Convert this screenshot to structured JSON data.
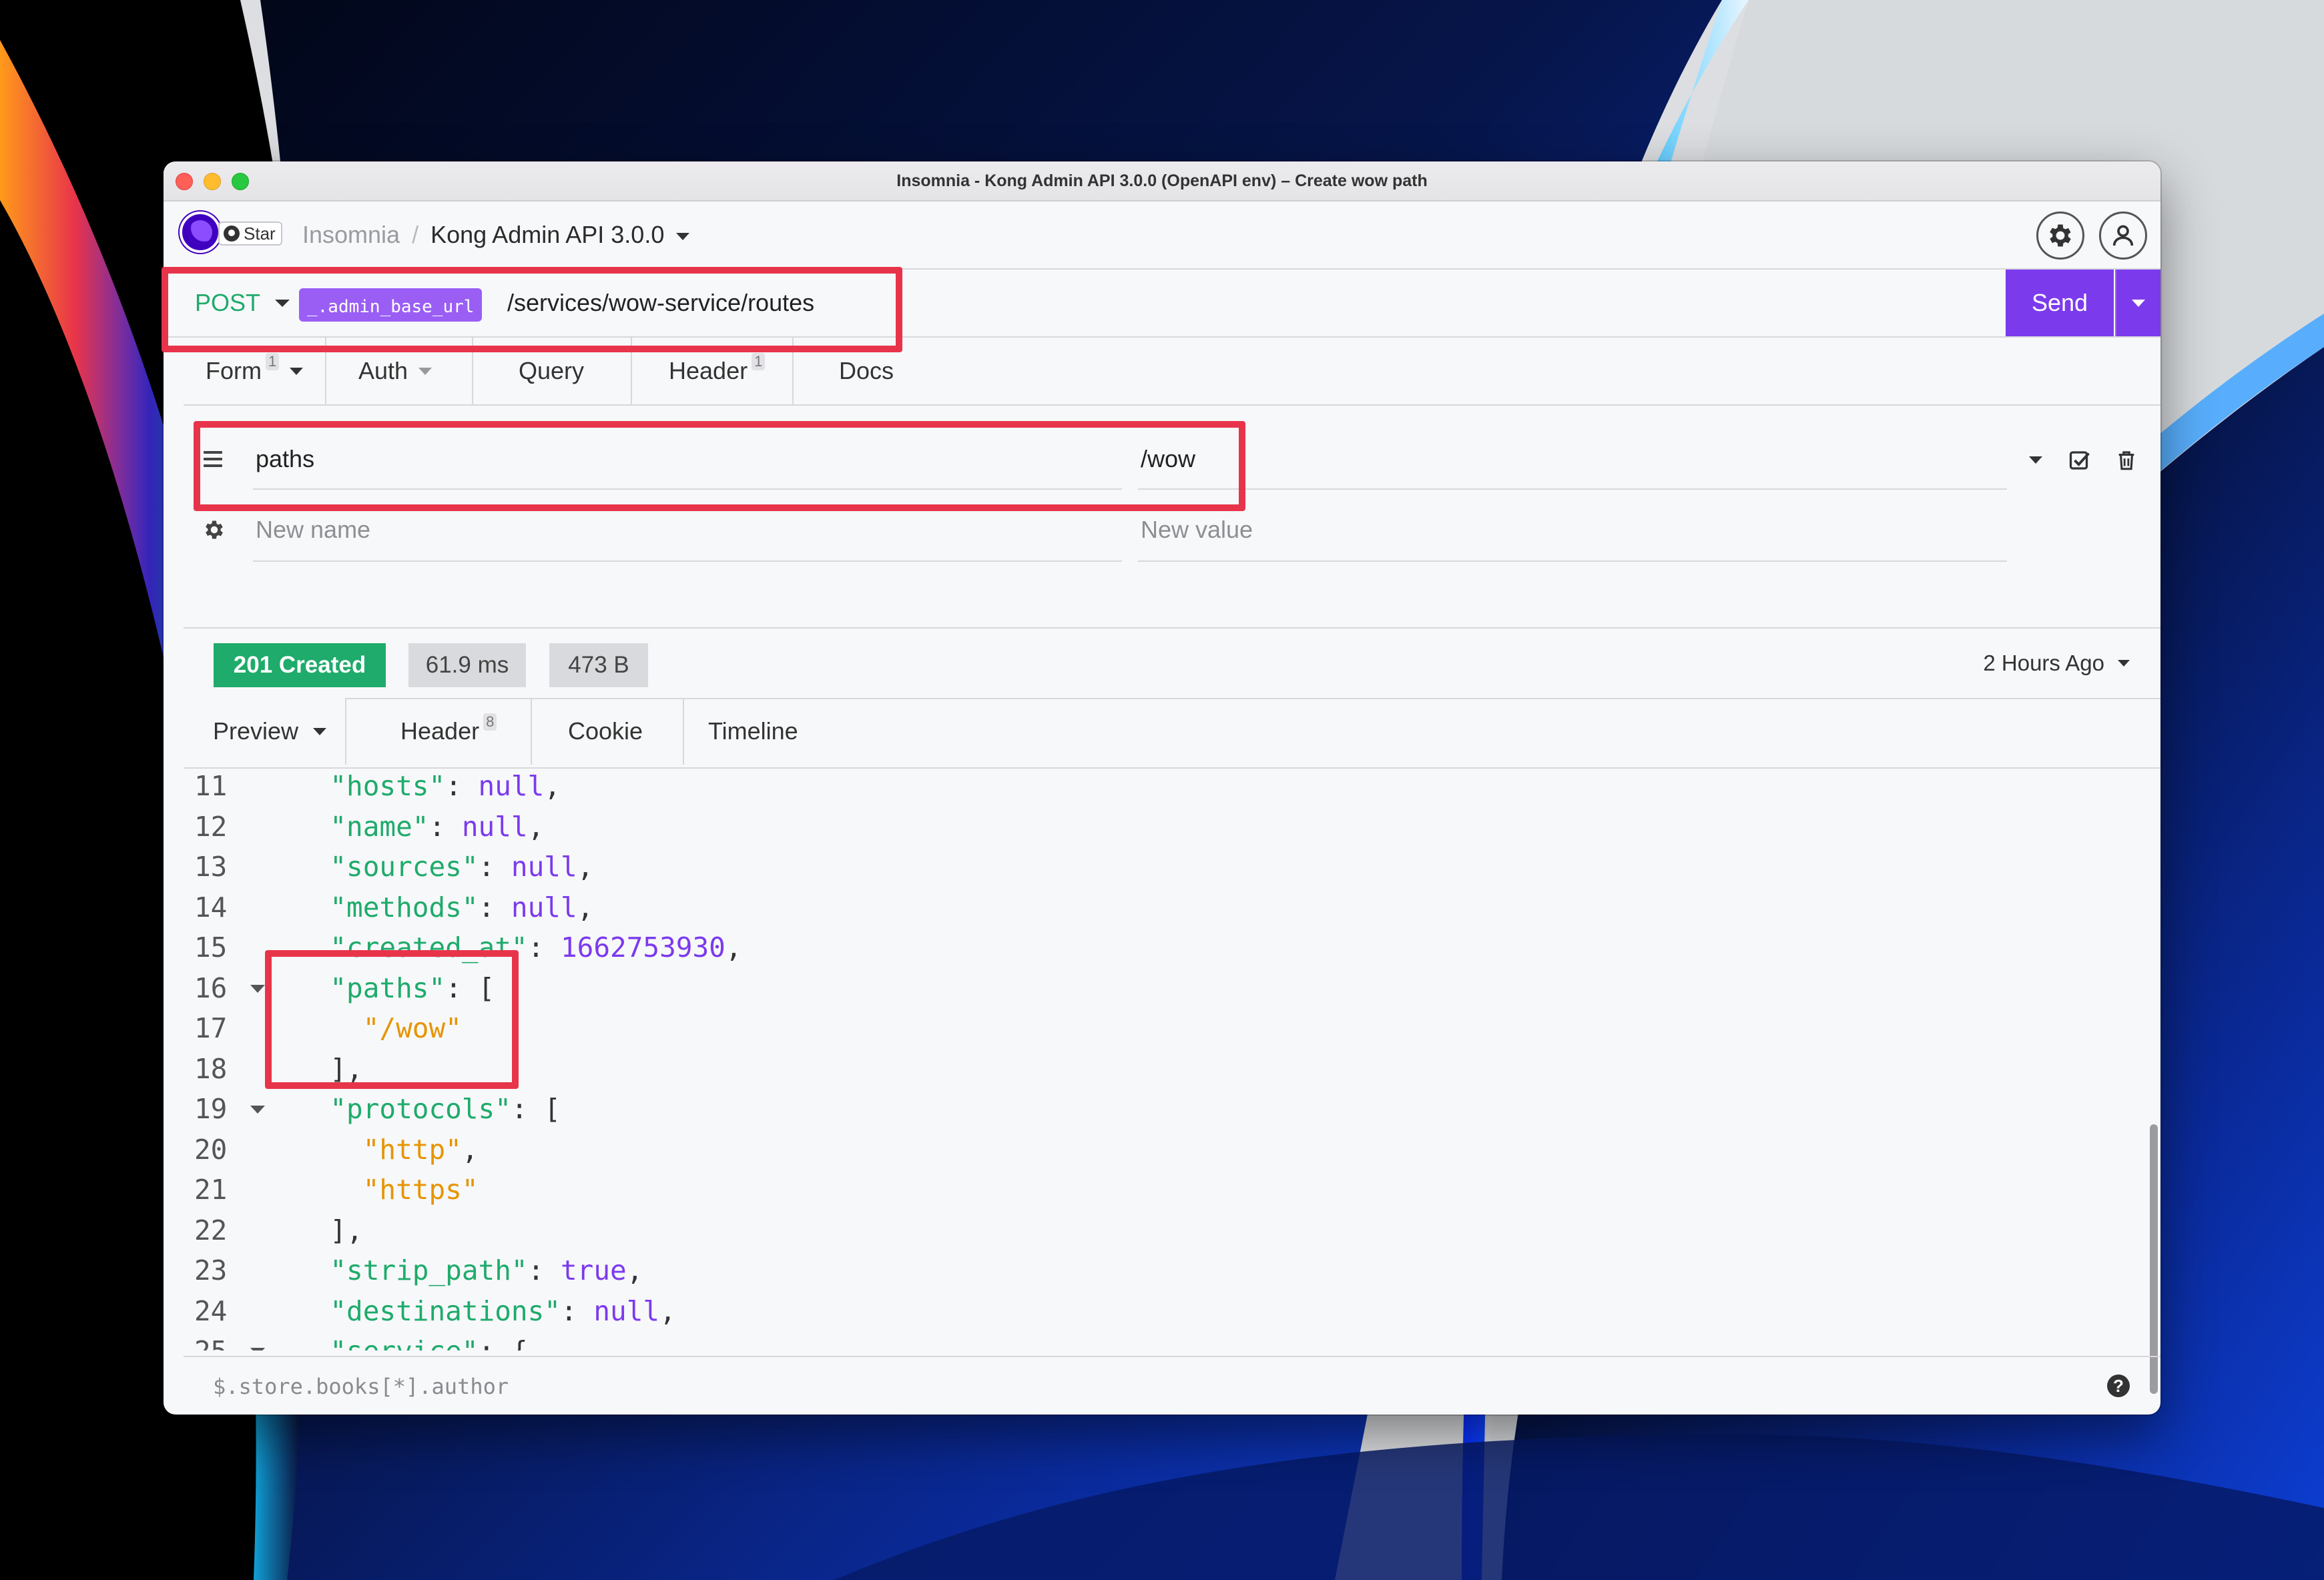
{
  "window": {
    "title": "Insomnia - Kong Admin API 3.0.0 (OpenAPI env) – Create wow path"
  },
  "header": {
    "star_label": "Star",
    "breadcrumb_app": "Insomnia",
    "breadcrumb_separator": "/",
    "workspace": "Kong Admin API 3.0.0"
  },
  "request": {
    "method": "POST",
    "env_var": "_.admin_base_url",
    "path": "/services/wow-service/routes",
    "send_label": "Send"
  },
  "request_tabs": [
    {
      "label": "Form",
      "count": "1"
    },
    {
      "label": "Auth"
    },
    {
      "label": "Query"
    },
    {
      "label": "Header",
      "count": "1"
    },
    {
      "label": "Docs"
    }
  ],
  "form": {
    "params": [
      {
        "name": "paths",
        "value": "/wow"
      }
    ],
    "new_name_placeholder": "New name",
    "new_value_placeholder": "New value"
  },
  "response": {
    "status": "201 Created",
    "time": "61.9 ms",
    "size": "473 B",
    "timestamp": "2 Hours Ago",
    "tabs": [
      {
        "label": "Preview"
      },
      {
        "label": "Header",
        "count": "8"
      },
      {
        "label": "Cookie"
      },
      {
        "label": "Timeline"
      }
    ],
    "lines": [
      {
        "no": "11",
        "tokens": [
          {
            "t": "  "
          },
          {
            "t": "\"hosts\"",
            "c": "k"
          },
          {
            "t": ": "
          },
          {
            "t": "null",
            "c": "n"
          },
          {
            "t": ","
          }
        ]
      },
      {
        "no": "12",
        "tokens": [
          {
            "t": "  "
          },
          {
            "t": "\"name\"",
            "c": "k"
          },
          {
            "t": ": "
          },
          {
            "t": "null",
            "c": "n"
          },
          {
            "t": ","
          }
        ]
      },
      {
        "no": "13",
        "tokens": [
          {
            "t": "  "
          },
          {
            "t": "\"sources\"",
            "c": "k"
          },
          {
            "t": ": "
          },
          {
            "t": "null",
            "c": "n"
          },
          {
            "t": ","
          }
        ]
      },
      {
        "no": "14",
        "tokens": [
          {
            "t": "  "
          },
          {
            "t": "\"methods\"",
            "c": "k"
          },
          {
            "t": ": "
          },
          {
            "t": "null",
            "c": "n"
          },
          {
            "t": ","
          }
        ]
      },
      {
        "no": "15",
        "tokens": [
          {
            "t": "  "
          },
          {
            "t": "\"created_at\"",
            "c": "k"
          },
          {
            "t": ": "
          },
          {
            "t": "1662753930",
            "c": "n"
          },
          {
            "t": ","
          }
        ]
      },
      {
        "no": "16",
        "fold": true,
        "tokens": [
          {
            "t": "  "
          },
          {
            "t": "\"paths\"",
            "c": "k"
          },
          {
            "t": ": ["
          }
        ]
      },
      {
        "no": "17",
        "tokens": [
          {
            "t": "    "
          },
          {
            "t": "\"/wow\"",
            "c": "s"
          }
        ]
      },
      {
        "no": "18",
        "tokens": [
          {
            "t": "  ],"
          }
        ]
      },
      {
        "no": "19",
        "fold": true,
        "tokens": [
          {
            "t": "  "
          },
          {
            "t": "\"protocols\"",
            "c": "k"
          },
          {
            "t": ": ["
          }
        ]
      },
      {
        "no": "20",
        "tokens": [
          {
            "t": "    "
          },
          {
            "t": "\"http\"",
            "c": "s"
          },
          {
            "t": ","
          }
        ]
      },
      {
        "no": "21",
        "tokens": [
          {
            "t": "    "
          },
          {
            "t": "\"https\"",
            "c": "s"
          }
        ]
      },
      {
        "no": "22",
        "tokens": [
          {
            "t": "  ],"
          }
        ]
      },
      {
        "no": "23",
        "tokens": [
          {
            "t": "  "
          },
          {
            "t": "\"strip_path\"",
            "c": "k"
          },
          {
            "t": ": "
          },
          {
            "t": "true",
            "c": "n"
          },
          {
            "t": ","
          }
        ]
      },
      {
        "no": "24",
        "tokens": [
          {
            "t": "  "
          },
          {
            "t": "\"destinations\"",
            "c": "k"
          },
          {
            "t": ": "
          },
          {
            "t": "null",
            "c": "n"
          },
          {
            "t": ","
          }
        ]
      },
      {
        "no": "25",
        "fold": true,
        "tokens": [
          {
            "t": "  "
          },
          {
            "t": "\"service\"",
            "c": "k"
          },
          {
            "t": ": {"
          }
        ]
      }
    ],
    "filter_placeholder": "$.store.books[*].author"
  },
  "icons": {
    "settings": "gear-icon",
    "account": "user-icon",
    "drag": "drag-handle-icon",
    "param_settings": "cog-icon",
    "enable": "checkbox-checked-icon",
    "delete": "trash-icon",
    "help": "help-icon"
  },
  "colors": {
    "accent": "#7c3aed",
    "method": "#1fab6b",
    "status_ok": "#1fab6b",
    "json_key": "#1fab6b",
    "json_literal": "#7c3aed",
    "json_string": "#e69500",
    "annotation": "#e8344a"
  }
}
